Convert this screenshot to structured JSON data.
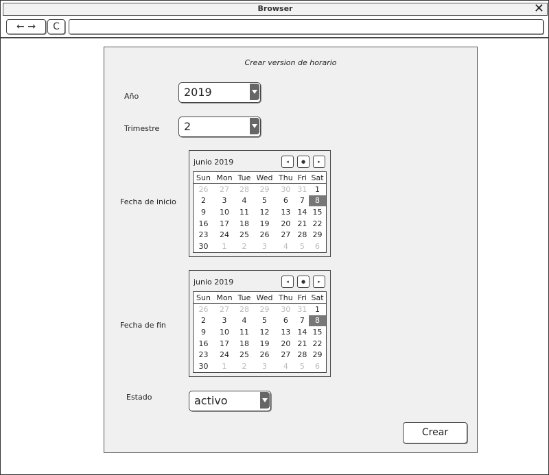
{
  "window": {
    "title": "Browser",
    "close_icon": "✕"
  },
  "toolbar": {
    "back_icon": "←",
    "forward_icon": "→",
    "refresh_icon": "C",
    "address": ""
  },
  "form": {
    "title": "Crear version de horario",
    "year_label": "Año",
    "year_value": "2019",
    "quarter_label": "Trimestre",
    "quarter_value": "2",
    "start_label": "Fecha de inicio",
    "end_label": "Fecha de fin",
    "state_label": "Estado",
    "state_value": "activo",
    "submit_label": "Crear"
  },
  "calendar": {
    "month_label": "junio 2019",
    "nav_prev": "◂",
    "nav_today": "●",
    "nav_next": "▸",
    "weekdays": [
      "Sun",
      "Mon",
      "Tue",
      "Wed",
      "Thu",
      "Fri",
      "Sat"
    ],
    "weeks": [
      [
        "26",
        "27",
        "28",
        "29",
        "30",
        "31",
        "1"
      ],
      [
        "2",
        "3",
        "4",
        "5",
        "6",
        "7",
        "8"
      ],
      [
        "9",
        "10",
        "11",
        "12",
        "13",
        "14",
        "15"
      ],
      [
        "16",
        "17",
        "18",
        "19",
        "20",
        "21",
        "22"
      ],
      [
        "23",
        "24",
        "25",
        "26",
        "27",
        "28",
        "29"
      ],
      [
        "30",
        "1",
        "2",
        "3",
        "4",
        "5",
        "6"
      ]
    ],
    "muted": [
      [
        0,
        0
      ],
      [
        0,
        1
      ],
      [
        0,
        2
      ],
      [
        0,
        3
      ],
      [
        0,
        4
      ],
      [
        0,
        5
      ],
      [
        5,
        1
      ],
      [
        5,
        2
      ],
      [
        5,
        3
      ],
      [
        5,
        4
      ],
      [
        5,
        5
      ],
      [
        5,
        6
      ]
    ],
    "selected": [
      1,
      6
    ]
  }
}
